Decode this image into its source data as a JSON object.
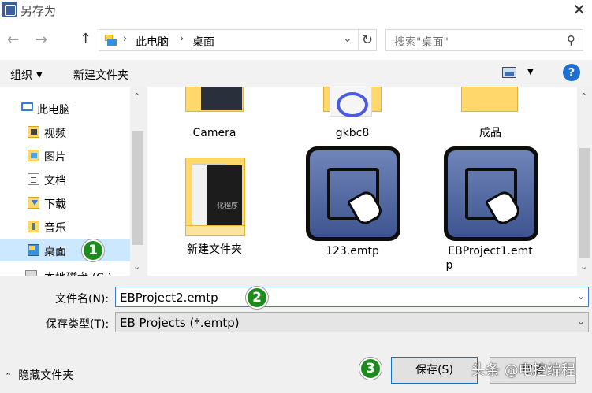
{
  "window": {
    "title": "另存为",
    "close": "✕"
  },
  "nav": {
    "back": "←",
    "forward": "→",
    "up": "↑",
    "breadcrumb": [
      "此电脑",
      "桌面"
    ],
    "breadcrumb_sep": "›",
    "dropdown": "⌄",
    "refresh": "↻",
    "search_placeholder": "搜索\"桌面\"",
    "search_icon": "⚲"
  },
  "toolbar": {
    "organize": "组织",
    "organize_caret": "▼",
    "new_folder": "新建文件夹",
    "view_caret": "▼",
    "help": "?"
  },
  "sidebar": {
    "items": [
      {
        "label": "此电脑",
        "icon": "computer-icon"
      },
      {
        "label": "视频",
        "icon": "videos-folder-icon"
      },
      {
        "label": "图片",
        "icon": "pictures-folder-icon"
      },
      {
        "label": "文档",
        "icon": "documents-folder-icon"
      },
      {
        "label": "下载",
        "icon": "downloads-folder-icon"
      },
      {
        "label": "音乐",
        "icon": "music-folder-icon"
      },
      {
        "label": "桌面",
        "icon": "desktop-folder-icon",
        "selected": true
      },
      {
        "label": "本地磁盘 (C:)",
        "icon": "drive-icon"
      }
    ]
  },
  "files": [
    {
      "name": "Camera",
      "type": "folder"
    },
    {
      "name": "gkbc8",
      "type": "folder"
    },
    {
      "name": "成品",
      "type": "folder"
    },
    {
      "name": "新建文件夹",
      "type": "folder",
      "preview_text": "化程序"
    },
    {
      "name": "123.emtp",
      "type": "emtp"
    },
    {
      "name_line1": "EBProject1.emt",
      "name_line2": "p",
      "type": "emtp"
    }
  ],
  "form": {
    "filename_label": "文件名(N):",
    "filename_value": "EBProject2.emtp",
    "filetype_label": "保存类型(T):",
    "filetype_value": "EB Projects (*.emtp)",
    "caret": "⌄"
  },
  "footer": {
    "hide_folders": "隐藏文件夹",
    "chevron": "⌃",
    "save": "保存(S)",
    "cancel": "取消"
  },
  "annotations": [
    "1",
    "2",
    "3"
  ],
  "watermark": "头条 @电控编程",
  "scroll": {
    "up": "⌃",
    "down": "⌄"
  }
}
